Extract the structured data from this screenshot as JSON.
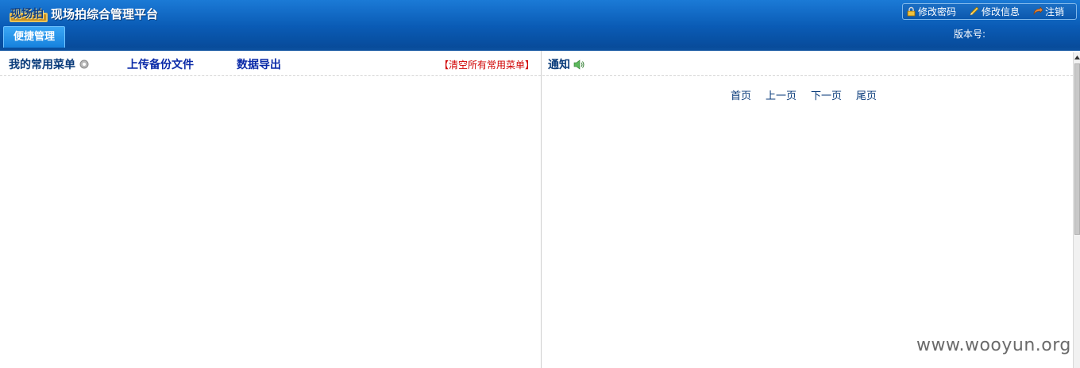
{
  "header": {
    "logo_mark_text": "现场拍",
    "logo_text": "现场拍综合管理平台",
    "active_tab": "便捷管理",
    "version_label": "版本号:",
    "user_menu": [
      {
        "label": "修改密码",
        "icon": "lock-icon"
      },
      {
        "label": "修改信息",
        "icon": "pencil-icon"
      },
      {
        "label": "注销",
        "icon": "logout-icon"
      }
    ]
  },
  "left": {
    "my_menu": "我的常用菜单",
    "upload": "上传备份文件",
    "export": "数据导出",
    "clear_all": "【清空所有常用菜单】"
  },
  "right": {
    "notice_title": "通知",
    "pager": [
      "首页",
      "上一页",
      "下一页",
      "尾页"
    ]
  },
  "watermark": "www.wooyun.org",
  "colors": {
    "header_blue": "#0a5bb5",
    "link_blue": "#083a7a",
    "danger_red": "#d00000"
  }
}
